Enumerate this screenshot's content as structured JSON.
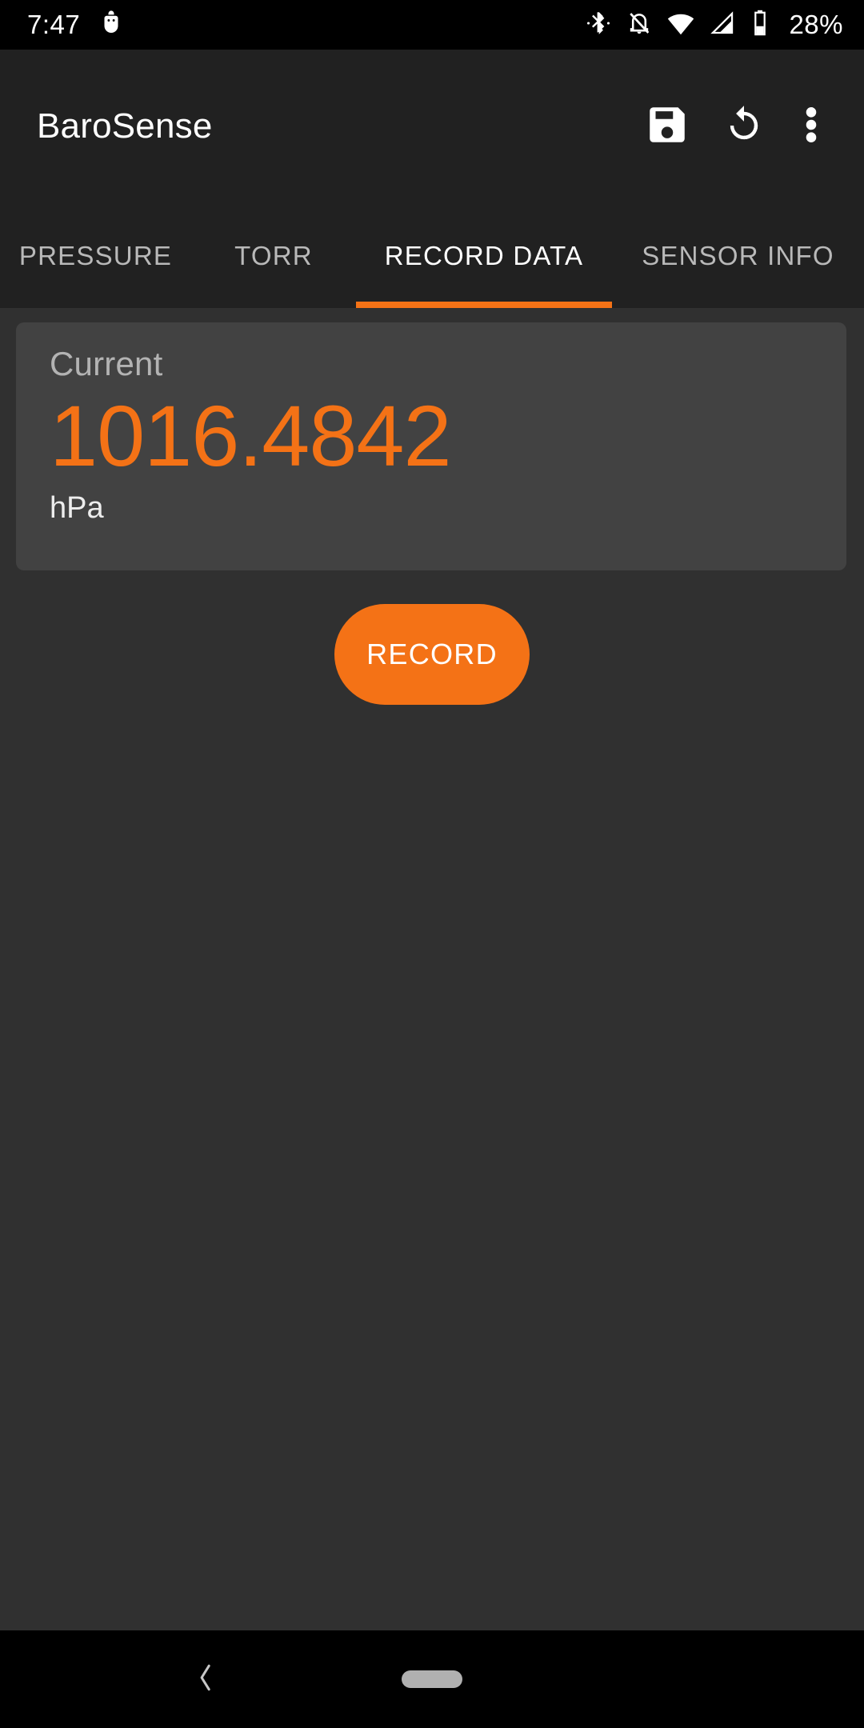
{
  "statusbar": {
    "clock": "7:47",
    "battery_percent": "28%",
    "icons": {
      "app_notification": "android-debug-icon",
      "bluetooth": "bluetooth-icon",
      "notifications_off": "bell-off-icon",
      "wifi": "wifi-icon",
      "signal": "cell-signal-icon",
      "battery": "battery-icon"
    }
  },
  "appbar": {
    "title": "BaroSense",
    "actions": {
      "save_label": "save-icon",
      "refresh_label": "refresh-icon",
      "overflow_label": "more-vertical-icon"
    }
  },
  "tabs": {
    "items": [
      {
        "label": "PRESSURE",
        "active": false
      },
      {
        "label": "TORR",
        "active": false
      },
      {
        "label": "RECORD DATA",
        "active": true
      },
      {
        "label": "SENSOR INFO",
        "active": false
      }
    ],
    "active_index": 2,
    "indicator_color": "#f47216"
  },
  "main": {
    "reading_card": {
      "label": "Current",
      "value": "1016.4842",
      "unit": "hPa",
      "value_color": "#f47216",
      "card_background": "#424242"
    },
    "record_button": {
      "label": "RECORD",
      "color": "#f47216"
    }
  },
  "navbar": {
    "back_label": "back-chevron-icon",
    "home_label": "home-pill-icon"
  },
  "theme": {
    "accent": "#f47216",
    "appbar_background": "#212121",
    "content_background": "#303030",
    "status_background": "#000000"
  }
}
